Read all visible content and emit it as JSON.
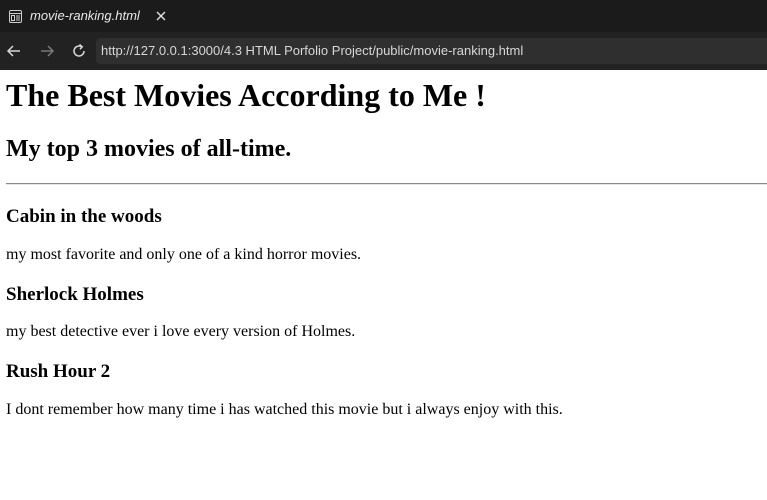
{
  "browser": {
    "tab": {
      "title": "movie-ranking.html",
      "icon": "reader-page-icon",
      "close_icon": "close-icon"
    },
    "nav": {
      "back_icon": "arrow-left-icon",
      "forward_icon": "arrow-right-icon",
      "reload_icon": "reload-icon"
    },
    "url": "http://127.0.0.1:3000/4.3 HTML Porfolio Project/public/movie-ranking.html"
  },
  "page": {
    "heading": "The Best Movies According to Me !",
    "subheading": "My top 3 movies of all-time.",
    "movies": [
      {
        "title": "Cabin in the woods",
        "description": "my most favorite and only one of a kind horror movies."
      },
      {
        "title": "Sherlock Holmes",
        "description": "my best detective ever i love every version of Holmes."
      },
      {
        "title": "Rush Hour 2",
        "description": "I dont remember how many time i has watched this movie but i always enjoy with this."
      }
    ]
  },
  "colors": {
    "chrome_dark": "#1b1b1b",
    "navbar": "#222222",
    "urlbar": "#2f2f2f",
    "url_text": "#d7d7d7",
    "page_bg": "#ffffff"
  }
}
